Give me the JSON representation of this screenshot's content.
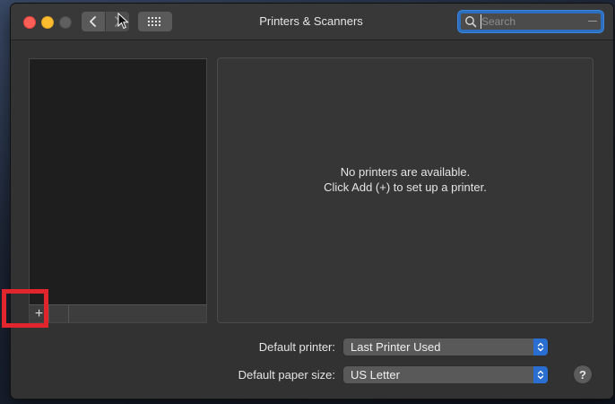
{
  "window": {
    "title": "Printers & Scanners"
  },
  "toolbar": {
    "back_icon": "chevron-left-icon",
    "forward_icon": "chevron-right-icon",
    "grid_icon": "grid-icon"
  },
  "search": {
    "placeholder": "Search",
    "value": ""
  },
  "printer_list": {
    "items": [],
    "add_label": "+"
  },
  "detail": {
    "empty_line1": "No printers are available.",
    "empty_line2": "Click Add (+) to set up a printer."
  },
  "settings": {
    "default_printer_label": "Default printer:",
    "default_printer_value": "Last Printer Used",
    "paper_size_label": "Default paper size:",
    "paper_size_value": "US Letter"
  },
  "help": {
    "label": "?"
  },
  "colors": {
    "accent": "#2a6ed1",
    "highlight": "#e0262c",
    "close": "#ff5f57",
    "minimize": "#febc2e"
  }
}
